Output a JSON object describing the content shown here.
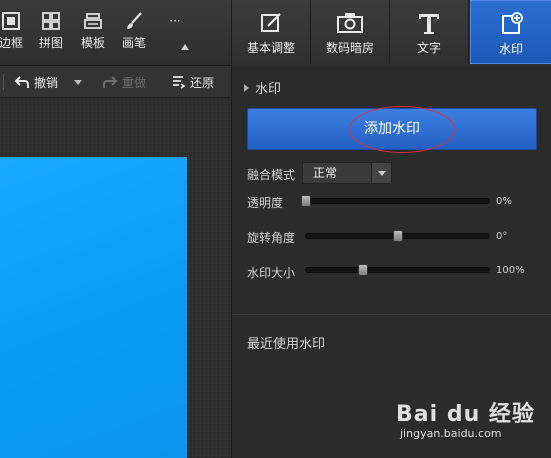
{
  "left_toolbar": {
    "items": [
      {
        "label": "边框",
        "icon": "frame-icon"
      },
      {
        "label": "拼图",
        "icon": "grid-icon"
      },
      {
        "label": "模板",
        "icon": "template-icon"
      },
      {
        "label": "画笔",
        "icon": "brush-icon"
      },
      {
        "label": "···",
        "icon": "more-icon"
      }
    ]
  },
  "undo_bar": {
    "undo_label": "撤销",
    "redo_label": "重做",
    "restore_label": "还原"
  },
  "right_tabs": {
    "items": [
      {
        "label": "基本调整",
        "icon": "edit-icon"
      },
      {
        "label": "数码暗房",
        "icon": "camera-icon"
      },
      {
        "label": "文字",
        "icon": "text-icon"
      },
      {
        "label": "水印",
        "icon": "watermark-icon",
        "active": true
      }
    ]
  },
  "panel": {
    "section_title": "水印",
    "add_button": "添加水印",
    "blend_mode_label": "融合模式",
    "blend_mode_value": "正常",
    "sliders": [
      {
        "label": "透明度",
        "value_text": "0%",
        "value": 0
      },
      {
        "label": "旋转角度",
        "value_text": "0°",
        "value": 0.5
      },
      {
        "label": "水印大小",
        "value_text": "100%",
        "value": 0.31
      }
    ],
    "recent_title": "最近使用水印"
  },
  "colors": {
    "accent_blue": "#2a6ad0",
    "canvas_image": "#0a9cf5",
    "highlight_circle": "#e03030"
  },
  "watermark": {
    "main": "Bai du 经验",
    "sub": "jingyan.baidu.com"
  }
}
